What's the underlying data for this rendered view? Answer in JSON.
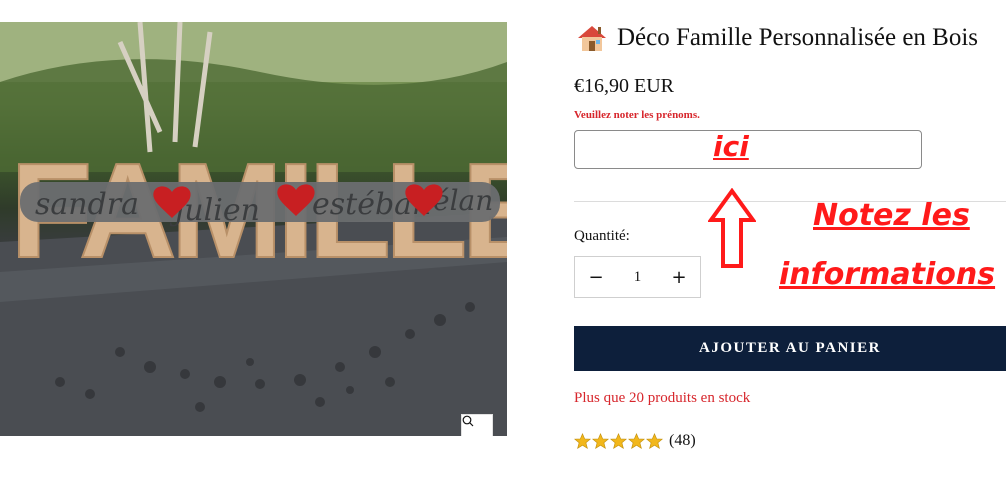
{
  "product": {
    "title_emoji": "house-icon",
    "title": "Déco Famille Personnalisée en Bois",
    "price": "€16,90 EUR",
    "note_label": "Veuillez noter les prénoms.",
    "names_input_value": "",
    "quantity_label": "Quantité:",
    "quantity_value": "1",
    "minus_symbol": "−",
    "plus_symbol": "+",
    "add_to_cart_label": "AJOUTER AU PANIER",
    "stock_text": "Plus que 20 produits en stock",
    "rating": {
      "stars": 5,
      "count_text": "(48)"
    }
  },
  "image": {
    "famille_text": "FAMILLE",
    "names": [
      "sandra",
      "julien",
      "estéban",
      "élan"
    ]
  },
  "annotations": {
    "field_hint": "ici",
    "line1": "Notez les",
    "line2": "informations"
  },
  "colors": {
    "accent_red": "#d7262c",
    "annotation_red": "#ff1a1a",
    "button_navy": "#0d1f3b",
    "star_gold": "#f2b71b"
  }
}
